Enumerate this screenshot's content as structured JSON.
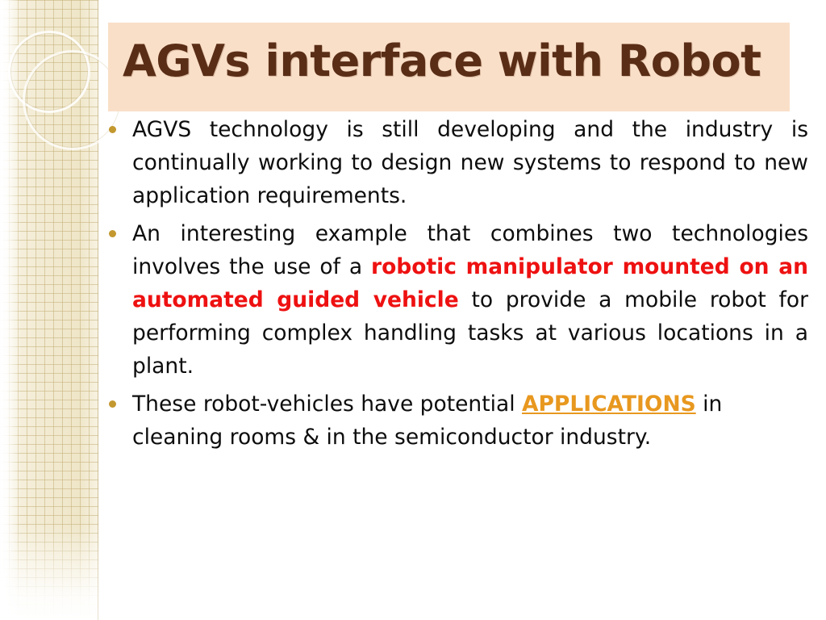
{
  "slide": {
    "title": "AGVs interface with Robot",
    "title_bg_color": "#fadfc8",
    "title_text_color": "#5a2d16",
    "accent_red": "#ee1111",
    "accent_orange": "#e8981f",
    "bullets": [
      {
        "id": "bullet-1",
        "segments": [
          {
            "text": "AGVS technology is still developing and the industry is continually working to design new systems to respond to new application requirements.",
            "style": "normal"
          }
        ]
      },
      {
        "id": "bullet-2",
        "segments": [
          {
            "text": "An interesting example that combines two technologies involves the use of a ",
            "style": "normal"
          },
          {
            "text": "robotic manipulator mounted on an automated guided vehicle",
            "style": "red-bold"
          },
          {
            "text": " to provide a mobile robot for performing complex handling tasks at various locations in a plant.",
            "style": "normal"
          }
        ]
      },
      {
        "id": "bullet-3",
        "segments": [
          {
            "text": "These robot-vehicles have potential ",
            "style": "normal"
          },
          {
            "text": "APPLICATIONS",
            "style": "orange-underline"
          },
          {
            "text": " in cleaning rooms & in the semiconductor industry.",
            "style": "normal"
          }
        ]
      }
    ]
  }
}
